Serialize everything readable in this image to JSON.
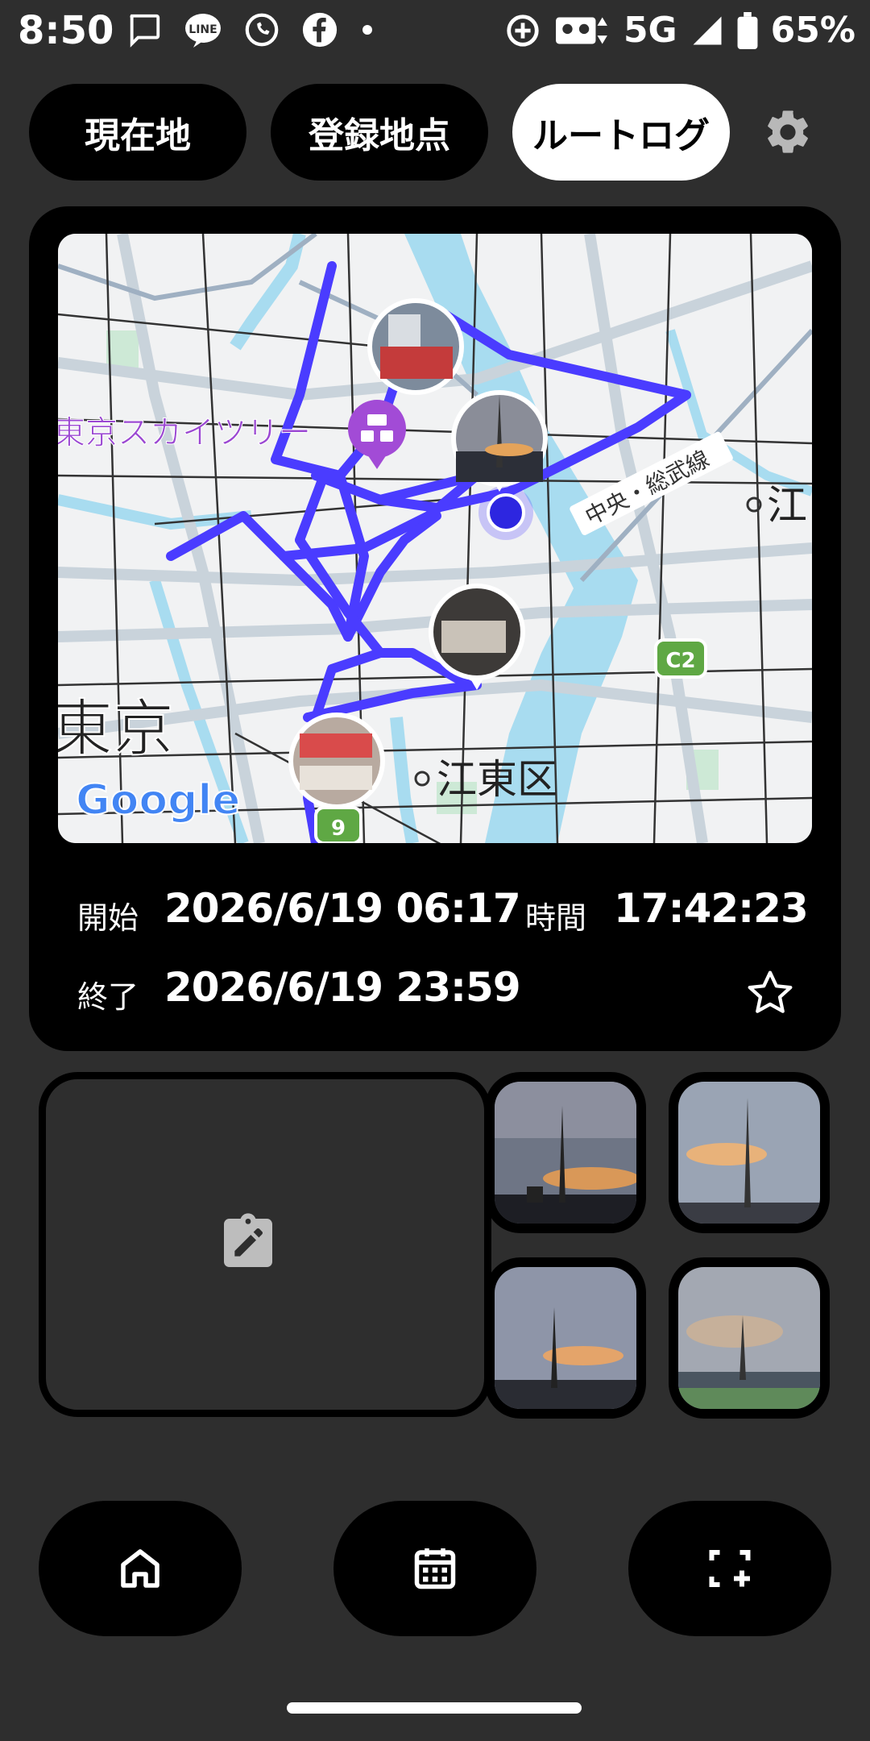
{
  "status_bar": {
    "time": "8:50",
    "network": "5G",
    "battery": "65%",
    "notification_icons": [
      "message-icon",
      "line-icon",
      "whatsapp-icon",
      "facebook-icon",
      "dot-icon"
    ],
    "system_icons": [
      "data-saver-icon",
      "cassette-icon",
      "signal-icon",
      "battery-icon"
    ]
  },
  "tabs": [
    {
      "label": "現在地",
      "active": false
    },
    {
      "label": "登録地点",
      "active": false
    },
    {
      "label": "ルートログ",
      "active": true
    }
  ],
  "map": {
    "labels": {
      "skytree": "東京スカイツリー",
      "tokyo": "東京",
      "koto": "江東区",
      "koto_right": "江",
      "chuo_sobu": "中央・総武線",
      "c2": "C2",
      "route9": "9",
      "google": "Google"
    },
    "colors": {
      "route": "#4a3cff",
      "water": "#a8dcf0",
      "road": "#b8c8d8"
    }
  },
  "log": {
    "start_label": "開始",
    "start_value": "2026/6/19 06:17",
    "end_label": "終了",
    "end_value": "2026/6/19 23:59",
    "duration_label": "時間",
    "duration_value": "17:42:23"
  },
  "memo": {
    "icon": "clipboard-edit-icon"
  },
  "photos": [
    "skytree-sunset-1",
    "skytree-sunset-2",
    "skytree-sunset-3",
    "skytree-sunset-4"
  ],
  "nav": [
    {
      "name": "home",
      "icon": "home-icon"
    },
    {
      "name": "calendar",
      "icon": "calendar-icon"
    },
    {
      "name": "add-frame",
      "icon": "add-frame-icon"
    }
  ]
}
